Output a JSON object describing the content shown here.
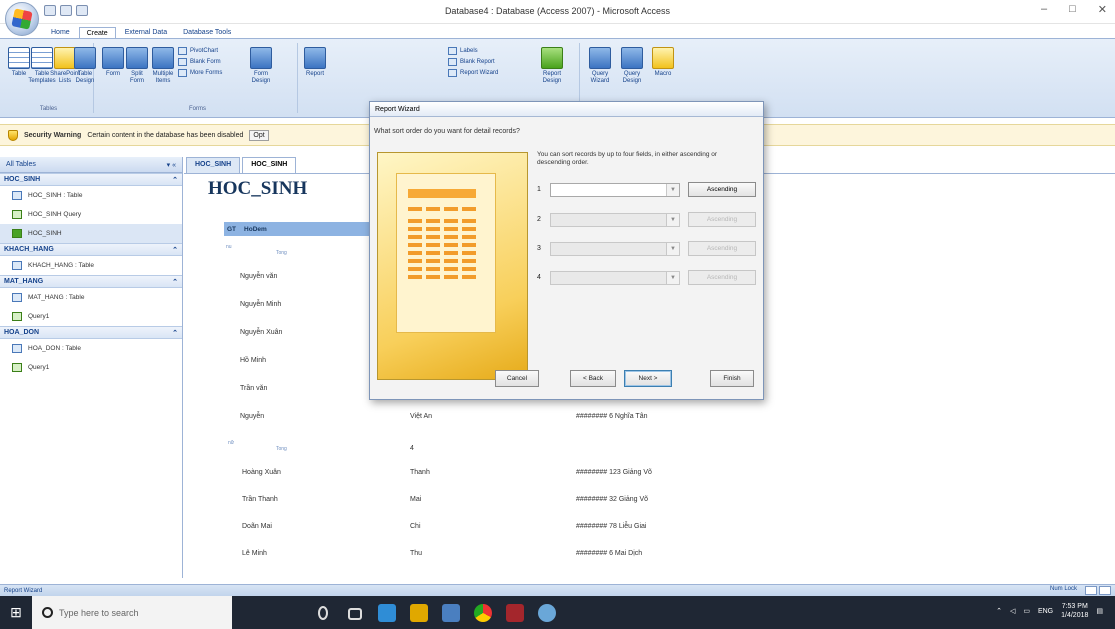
{
  "window": {
    "title": "Database4 : Database (Access 2007) - Microsoft Access"
  },
  "ribbon": {
    "tabs": [
      "Home",
      "Create",
      "External Data",
      "Database Tools"
    ],
    "groups": [
      {
        "label": "Tables",
        "buttons": [
          "Table",
          "Table Templates",
          "SharePoint Lists",
          "Table Design"
        ]
      },
      {
        "label": "Forms",
        "buttons": [
          "Form",
          "Split Form",
          "Multiple Items",
          "Form Design"
        ],
        "small": [
          "PivotChart",
          "Blank Form",
          "More Forms"
        ]
      },
      {
        "label": "Reports",
        "buttons": [
          "Report",
          "Report Design"
        ],
        "small": [
          "Labels",
          "Blank Report",
          "Report Wizard"
        ]
      },
      {
        "label": "Other",
        "buttons": [
          "Query Wizard",
          "Query Design",
          "Macro"
        ]
      }
    ]
  },
  "security": {
    "title": "Security Warning",
    "message": "Certain content in the database has been disabled",
    "options": "Opt"
  },
  "nav": {
    "header": "All Tables",
    "groups": [
      {
        "name": "HOC_SINH",
        "items": [
          {
            "label": "HOC_SINH : Table",
            "icon": "table-icon"
          },
          {
            "label": "HOC_SINH Query",
            "icon": "query-icon"
          },
          {
            "label": "HOC_SINH",
            "icon": "report-icon",
            "selected": true
          }
        ]
      },
      {
        "name": "KHACH_HANG",
        "items": [
          {
            "label": "KHACH_HANG : Table",
            "icon": "table-icon"
          }
        ]
      },
      {
        "name": "MAT_HANG",
        "items": [
          {
            "label": "MAT_HANG : Table",
            "icon": "table-icon"
          },
          {
            "label": "Query1",
            "icon": "query-icon"
          }
        ]
      },
      {
        "name": "HOA_DON",
        "items": [
          {
            "label": "HOA_DON : Table",
            "icon": "table-icon"
          },
          {
            "label": "Query1",
            "icon": "query-icon"
          }
        ]
      }
    ]
  },
  "doc_tabs": [
    "HOC_SINH",
    "HOC_SINH"
  ],
  "report": {
    "title": "HOC_SINH",
    "header_cols": [
      "GT",
      "HoDem"
    ],
    "group1_label": "nu",
    "group2_label": "nữ",
    "tong_label": "Tong",
    "count2": "4",
    "names_top": [
      "Nguyễn văn",
      "Nguyễn Minh",
      "Nguyễn Xuân",
      "Hồ Minh",
      "Trần văn",
      "Nguyễn"
    ],
    "first_names_top": [
      "Việt An"
    ],
    "addr_top": [
      "######## 6 Nghĩa Tân"
    ],
    "names_bottom": [
      "Hoàng Xuân",
      "Trần Thanh",
      "Doãn Mai",
      "Lê Minh"
    ],
    "first_names_bottom": [
      "Thanh",
      "Mai",
      "Chi",
      "Thu"
    ],
    "addr_bottom": [
      "######## 123 Giảng Võ",
      "######## 32 Giảng Võ",
      "######## 78 Liễu Giai",
      "######## 6 Mai Dịch"
    ]
  },
  "wizard": {
    "title": "Report Wizard",
    "question": "What sort order do you want for detail records?",
    "hint": "You can sort records by up to four fields, in either ascending or descending order.",
    "rows": [
      {
        "num": "1",
        "button": "Ascending",
        "enabled": true
      },
      {
        "num": "2",
        "button": "Ascending",
        "enabled": false
      },
      {
        "num": "3",
        "button": "Ascending",
        "enabled": false
      },
      {
        "num": "4",
        "button": "Ascending",
        "enabled": false
      }
    ],
    "buttons": {
      "cancel": "Cancel",
      "back": "< Back",
      "next": "Next >",
      "finish": "Finish"
    }
  },
  "status": {
    "left": "Report Wizard",
    "right": "Num Lock"
  },
  "taskbar": {
    "search_placeholder": "Type here to search",
    "lang": "ENG",
    "time": "7:53 PM",
    "date": "1/4/2018"
  }
}
